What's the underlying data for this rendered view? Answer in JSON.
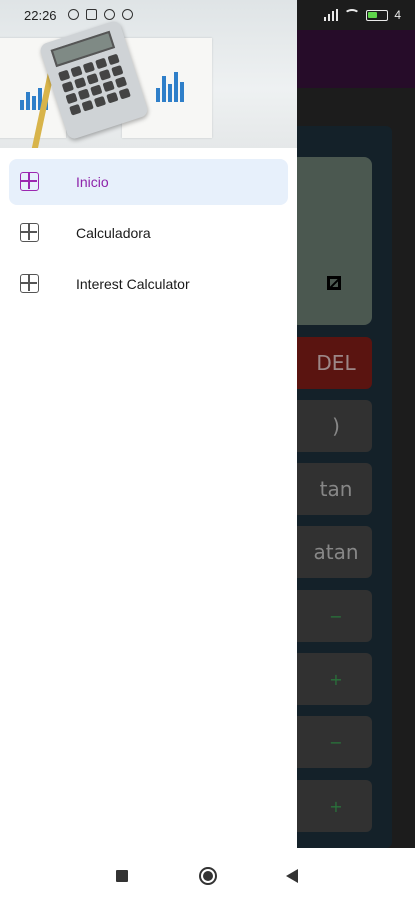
{
  "status_bar": {
    "time": "22:26",
    "battery_text": "4"
  },
  "drawer": {
    "items": [
      {
        "label": "Inicio",
        "active": true
      },
      {
        "label": "Calculadora",
        "active": false
      },
      {
        "label": "Interest Calculator",
        "active": false
      }
    ]
  },
  "background_app": {
    "keys": [
      "DEL",
      ")",
      "tan",
      "atan",
      "−",
      "+",
      "−",
      "+"
    ]
  },
  "colors": {
    "accent": "#8e24aa",
    "active_bg": "#e7f0fb",
    "app_bar": "#3b1340"
  },
  "icons": {
    "menu_item": "calculator-grid-icon",
    "nav_recents": "square-icon",
    "nav_home": "circle-icon",
    "nav_back": "triangle-back-icon"
  }
}
